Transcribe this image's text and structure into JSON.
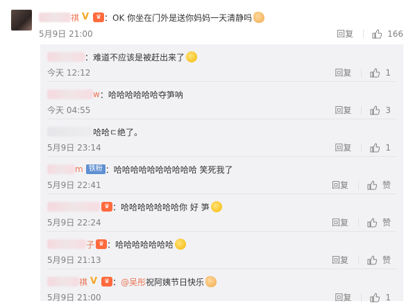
{
  "top_comment": {
    "username": "祺",
    "text": "：OK 你坐在门外是送你妈妈一天清静吗",
    "time": "5月9日 21:00",
    "reply_label": "回复",
    "like_count": "166"
  },
  "replies": [
    {
      "username": "",
      "text": "：难道不应该是被赶出来了",
      "time": "今天 12:12",
      "reply_label": "回复",
      "like_count": "1"
    },
    {
      "username": "w",
      "text": "：哈哈哈哈哈哈夺笋呐",
      "time": "今天 04:55",
      "reply_label": "回复",
      "like_count": "3"
    },
    {
      "username": "",
      "text": "哈哈ㄷ绝了。",
      "time": "5月9日 23:14",
      "reply_label": "回复",
      "like_count": "1"
    },
    {
      "username": "m",
      "tag": "铁粉",
      "text": "：哈哈哈哈哈哈哈哈哈哈 笑死我了",
      "time": "5月9日 22:41",
      "reply_label": "回复",
      "like_count": "赞"
    },
    {
      "username": "",
      "text": "：哈哈哈哈哈哈哈你 好 笋",
      "time": "5月9日 22:24",
      "reply_label": "回复",
      "like_count": "赞"
    },
    {
      "username": "子",
      "text": "：哈哈哈哈哈哈哈",
      "time": "5月9日 21:13",
      "reply_label": "回复",
      "like_count": "赞"
    },
    {
      "username": "祺",
      "mention": "@吴彤",
      "text": " 祝阿姨节日快乐",
      "time": "5月9日 21:00",
      "reply_label": "回复",
      "like_count": "1"
    }
  ]
}
